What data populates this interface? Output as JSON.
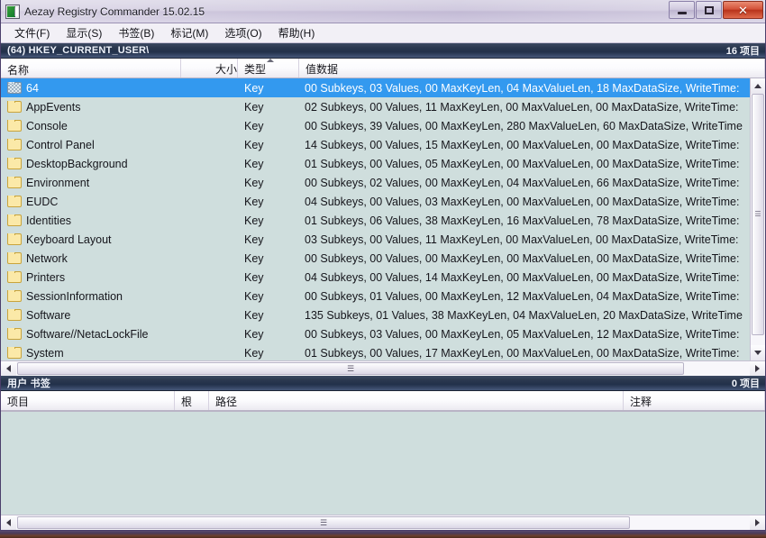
{
  "window": {
    "title": "Aezay Registry Commander 15.02.15",
    "icon": "app-icon",
    "buttons": {
      "minimize": "minimize",
      "maximize": "maximize",
      "close": "✕"
    }
  },
  "menubar": {
    "items": [
      {
        "label": "文件(F)",
        "name": "menu-file"
      },
      {
        "label": "显示(S)",
        "name": "menu-view"
      },
      {
        "label": "书签(B)",
        "name": "menu-bookmarks"
      },
      {
        "label": "标记(M)",
        "name": "menu-marks"
      },
      {
        "label": "选项(O)",
        "name": "menu-options"
      },
      {
        "label": "帮助(H)",
        "name": "menu-help"
      }
    ]
  },
  "pathbar": {
    "path": "(64) HKEY_CURRENT_USER\\",
    "count": "16 项目"
  },
  "list": {
    "columns": [
      {
        "label": "名称",
        "sorted": false
      },
      {
        "label": "大小",
        "sorted": false
      },
      {
        "label": "类型",
        "sorted": true
      },
      {
        "label": "值数据",
        "sorted": false
      }
    ],
    "rows": [
      {
        "name": "64",
        "size": "",
        "type": "Key",
        "data": "00 Subkeys, 03 Values, 00 MaxKeyLen, 04 MaxValueLen, 18 MaxDataSize, WriteTime:",
        "selected": true,
        "icon": "folder-checkered-icon"
      },
      {
        "name": "AppEvents",
        "size": "",
        "type": "Key",
        "data": "02 Subkeys, 00 Values, 11 MaxKeyLen, 00 MaxValueLen, 00 MaxDataSize, WriteTime:",
        "selected": false,
        "icon": "folder-icon"
      },
      {
        "name": "Console",
        "size": "",
        "type": "Key",
        "data": "00 Subkeys, 39 Values, 00 MaxKeyLen, 280 MaxValueLen, 60 MaxDataSize, WriteTime",
        "selected": false,
        "icon": "folder-icon"
      },
      {
        "name": "Control Panel",
        "size": "",
        "type": "Key",
        "data": "14 Subkeys, 00 Values, 15 MaxKeyLen, 00 MaxValueLen, 00 MaxDataSize, WriteTime:",
        "selected": false,
        "icon": "folder-icon"
      },
      {
        "name": "DesktopBackground",
        "size": "",
        "type": "Key",
        "data": "01 Subkeys, 00 Values, 05 MaxKeyLen, 00 MaxValueLen, 00 MaxDataSize, WriteTime:",
        "selected": false,
        "icon": "folder-icon"
      },
      {
        "name": "Environment",
        "size": "",
        "type": "Key",
        "data": "00 Subkeys, 02 Values, 00 MaxKeyLen, 04 MaxValueLen, 66 MaxDataSize, WriteTime:",
        "selected": false,
        "icon": "folder-icon"
      },
      {
        "name": "EUDC",
        "size": "",
        "type": "Key",
        "data": "04 Subkeys, 00 Values, 03 MaxKeyLen, 00 MaxValueLen, 00 MaxDataSize, WriteTime:",
        "selected": false,
        "icon": "folder-icon"
      },
      {
        "name": "Identities",
        "size": "",
        "type": "Key",
        "data": "01 Subkeys, 06 Values, 38 MaxKeyLen, 16 MaxValueLen, 78 MaxDataSize, WriteTime:",
        "selected": false,
        "icon": "folder-icon"
      },
      {
        "name": "Keyboard Layout",
        "size": "",
        "type": "Key",
        "data": "03 Subkeys, 00 Values, 11 MaxKeyLen, 00 MaxValueLen, 00 MaxDataSize, WriteTime:",
        "selected": false,
        "icon": "folder-icon"
      },
      {
        "name": "Network",
        "size": "",
        "type": "Key",
        "data": "00 Subkeys, 00 Values, 00 MaxKeyLen, 00 MaxValueLen, 00 MaxDataSize, WriteTime:",
        "selected": false,
        "icon": "folder-icon"
      },
      {
        "name": "Printers",
        "size": "",
        "type": "Key",
        "data": "04 Subkeys, 00 Values, 14 MaxKeyLen, 00 MaxValueLen, 00 MaxDataSize, WriteTime:",
        "selected": false,
        "icon": "folder-icon"
      },
      {
        "name": "SessionInformation",
        "size": "",
        "type": "Key",
        "data": "00 Subkeys, 01 Values, 00 MaxKeyLen, 12 MaxValueLen, 04 MaxDataSize, WriteTime:",
        "selected": false,
        "icon": "folder-icon"
      },
      {
        "name": "Software",
        "size": "",
        "type": "Key",
        "data": "135 Subkeys, 01 Values, 38 MaxKeyLen, 04 MaxValueLen, 20 MaxDataSize, WriteTime",
        "selected": false,
        "icon": "folder-icon"
      },
      {
        "name": "Software//NetacLockFile",
        "size": "",
        "type": "Key",
        "data": "00 Subkeys, 03 Values, 00 MaxKeyLen, 05 MaxValueLen, 12 MaxDataSize, WriteTime:",
        "selected": false,
        "icon": "folder-icon"
      },
      {
        "name": "System",
        "size": "",
        "type": "Key",
        "data": "01 Subkeys, 00 Values, 17 MaxKeyLen, 00 MaxValueLen, 00 MaxDataSize, WriteTime:",
        "selected": false,
        "icon": "folder-icon"
      }
    ]
  },
  "bookmarks": {
    "title": "用户 书签",
    "count": "0 项目",
    "columns": [
      {
        "label": "项目"
      },
      {
        "label": "根"
      },
      {
        "label": "路径"
      },
      {
        "label": "注释"
      }
    ],
    "rows": []
  },
  "colors": {
    "selection": "#3399ef",
    "list_background": "#cfdedd",
    "header_bar": "#2c3950",
    "close_button": "#c4402a"
  }
}
